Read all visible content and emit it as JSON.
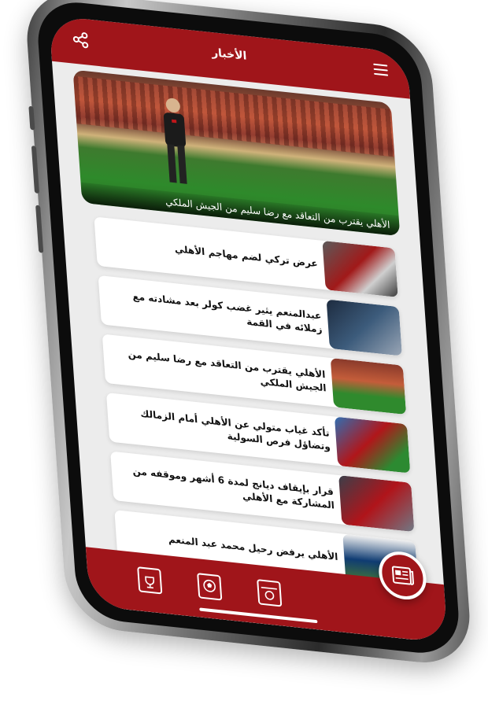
{
  "header": {
    "title": "الأخبار"
  },
  "hero": {
    "caption": "الأهلي يقترب من التعاقد مع رضا سليم من الجيش الملكي"
  },
  "news": [
    {
      "title": "عرض تركي لضم مهاجم الأهلي"
    },
    {
      "title": "عبدالمنعم يثير غضب كولر بعد مشادته مع زملائه في القمة"
    },
    {
      "title": "الأهلي يقترب من التعاقد مع رضا سليم من الجيش الملكي"
    },
    {
      "title": "تأكد غياب متولي عن الأهلي أمام الزمالك وتضاؤل فرص السولية"
    },
    {
      "title": "قرار بإيقاف ديانج لمدة 6 أشهر وموقفه من المشاركة مع الأهلي"
    },
    {
      "title": "الأهلي يرفض رحيل محمد عبد المنعم"
    }
  ],
  "colors": {
    "primary": "#a0151a",
    "background": "#ececec",
    "card": "#ffffff"
  },
  "icons": {
    "share": "share-icon",
    "menu": "hamburger-menu-icon",
    "nav1": "calendar-trophy-icon",
    "nav2": "football-screen-icon",
    "nav3": "match-calendar-icon",
    "fab": "newspaper-icon"
  }
}
